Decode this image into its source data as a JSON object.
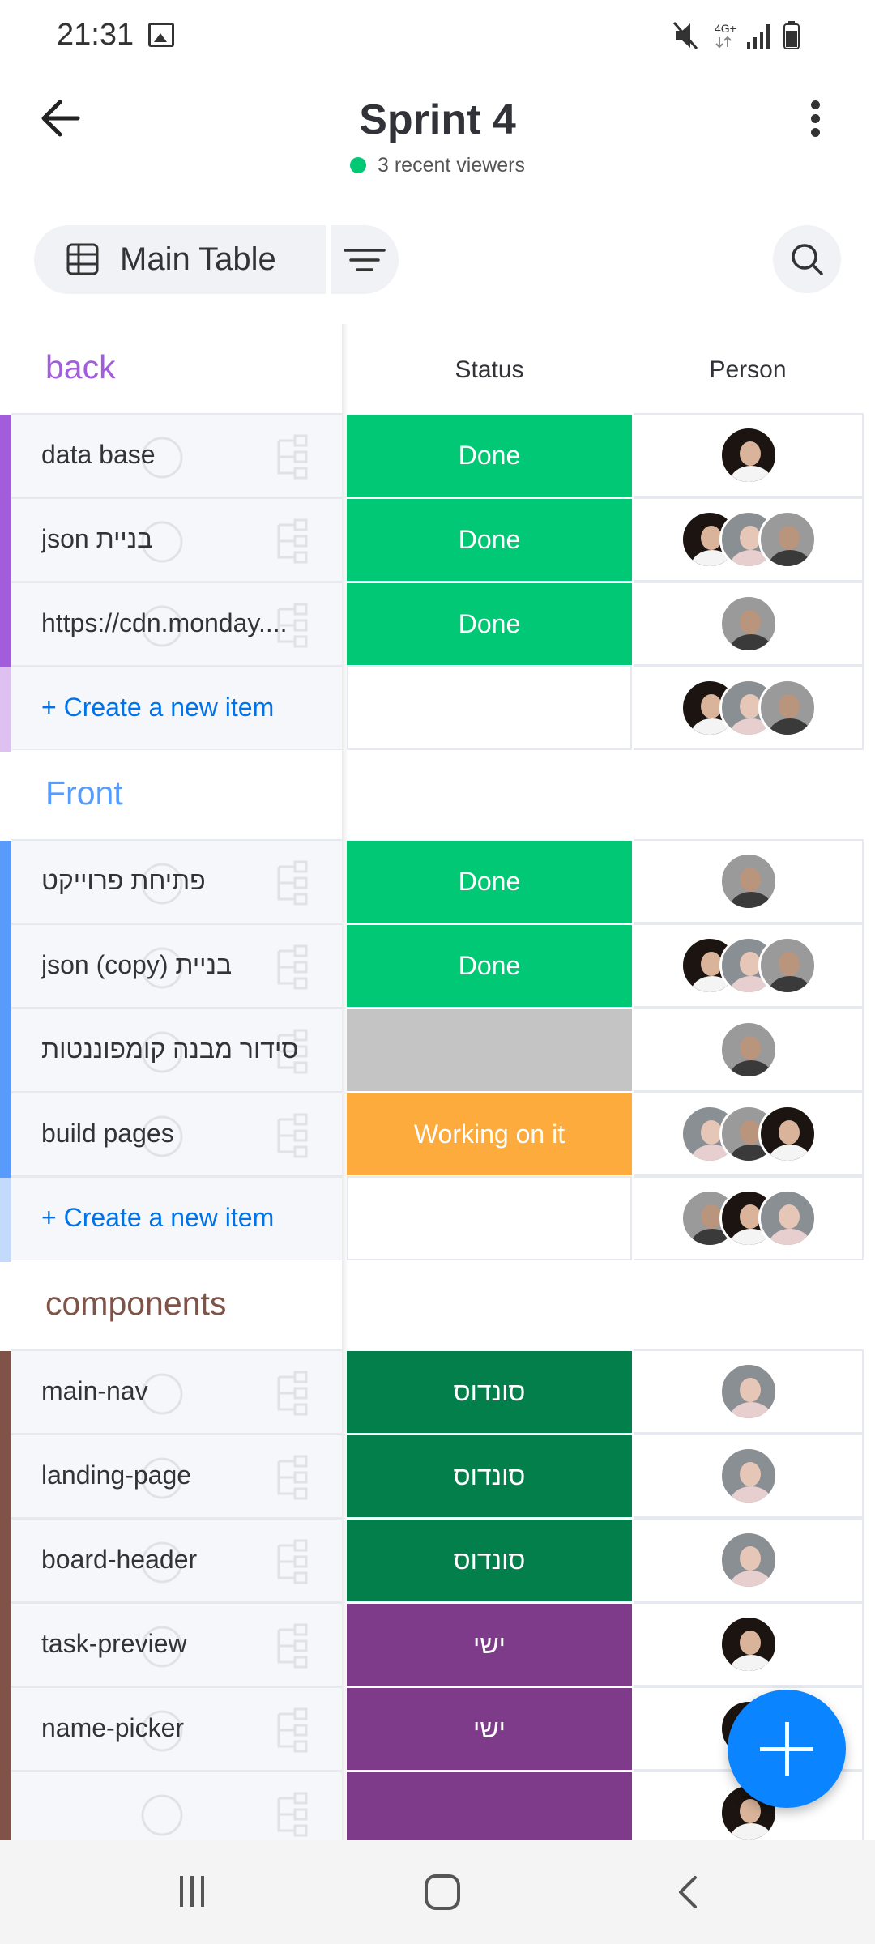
{
  "status_bar": {
    "time": "21:31",
    "network": "4G+"
  },
  "header": {
    "title": "Sprint 4",
    "viewers": "3 recent viewers"
  },
  "toolbar": {
    "table_label": "Main Table"
  },
  "columns": {
    "status": "Status",
    "person": "Person"
  },
  "colors": {
    "done": "#00c875",
    "stuck_grey": "#c4c4c4",
    "working": "#fdab3d",
    "dark_green": "#037f4c",
    "purple": "#7e3b8a",
    "accent": "#0073ea"
  },
  "groups": [
    {
      "name": "back",
      "color": "#a25ddc",
      "color_light": "#dcc1f1",
      "rows": [
        {
          "name": "data base",
          "status": "Done",
          "status_color": "#00c875",
          "people": [
            "p1"
          ]
        },
        {
          "name": "json בניית",
          "status": "Done",
          "status_color": "#00c875",
          "people": [
            "p1",
            "p2",
            "p3"
          ]
        },
        {
          "name": "https://cdn.monday....",
          "status": "Done",
          "status_color": "#00c875",
          "people": [
            "p3"
          ]
        }
      ],
      "create_label": "+ Create a new item",
      "create_people": [
        "p1",
        "p2",
        "p3"
      ]
    },
    {
      "name": "Front",
      "color": "#579bfc",
      "color_light": "#c4dafd",
      "rows": [
        {
          "name": "פתיחת פרוייקט",
          "status": "Done",
          "status_color": "#00c875",
          "people": [
            "p3"
          ]
        },
        {
          "name": "json (copy) בניית",
          "status": "Done",
          "status_color": "#00c875",
          "people": [
            "p1",
            "p2",
            "p3"
          ]
        },
        {
          "name": "סידור מבנה קומפוננטות",
          "status": "",
          "status_color": "#c4c4c4",
          "people": [
            "p3"
          ]
        },
        {
          "name": "build pages",
          "status": "Working on it",
          "status_color": "#fdab3d",
          "people": [
            "p2",
            "p3",
            "p1"
          ]
        }
      ],
      "create_label": "+ Create a new item",
      "create_people": [
        "p3",
        "p1",
        "p2"
      ]
    },
    {
      "name": "components",
      "color": "#7f5347",
      "color_light": "#d8c7c2",
      "rows": [
        {
          "name": "main-nav",
          "status": "סונדוס",
          "status_color": "#037f4c",
          "people": [
            "p2"
          ]
        },
        {
          "name": "landing-page",
          "status": "סונדוס",
          "status_color": "#037f4c",
          "people": [
            "p2"
          ]
        },
        {
          "name": "board-header",
          "status": "סונדוס",
          "status_color": "#037f4c",
          "people": [
            "p2"
          ]
        },
        {
          "name": "task-preview",
          "status": "ישי",
          "status_color": "#7e3b8a",
          "people": [
            "p1"
          ]
        },
        {
          "name": "name-picker",
          "status": "ישי",
          "status_color": "#7e3b8a",
          "people": [
            "p1"
          ]
        },
        {
          "name": "",
          "status": "",
          "status_color": "#7e3b8a",
          "people": [
            "p1"
          ]
        }
      ]
    }
  ]
}
